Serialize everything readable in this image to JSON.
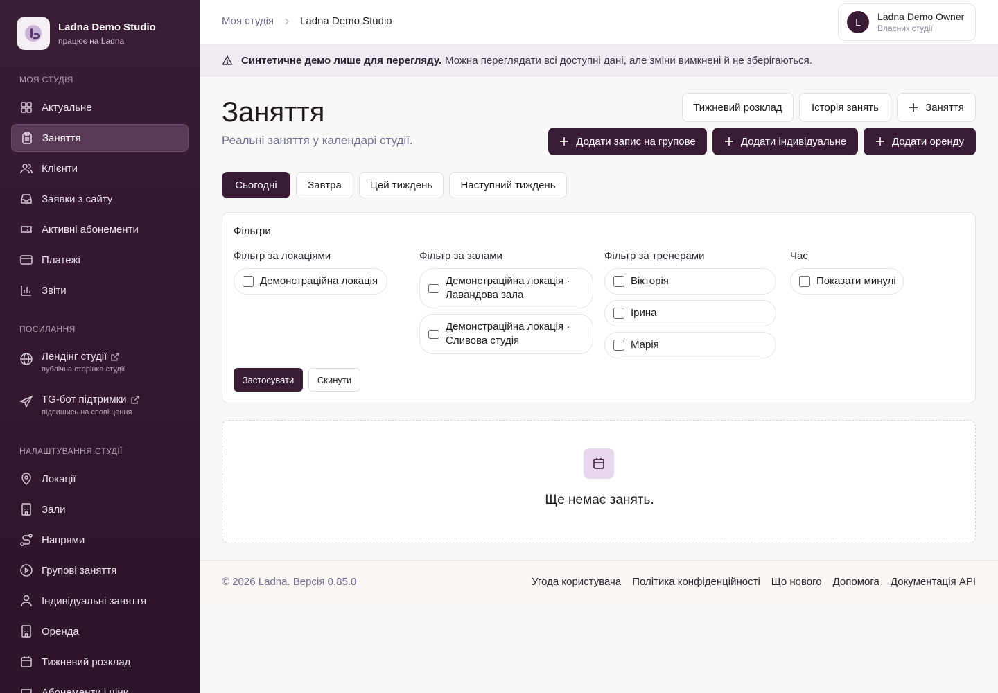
{
  "brand": {
    "name": "Ladna Demo Studio",
    "sub": "працює на Ladna"
  },
  "sidebar": {
    "sections": {
      "studio": "МОЯ СТУДІЯ",
      "links": "ПОСИЛАННЯ",
      "settings": "НАЛАШТУВАННЯ СТУДІЇ"
    },
    "studio_items": [
      {
        "label": "Актуальне",
        "icon": "dashboard-icon"
      },
      {
        "label": "Заняття",
        "icon": "clipboard-icon",
        "active": true
      },
      {
        "label": "Клієнти",
        "icon": "users-icon"
      },
      {
        "label": "Заявки з сайту",
        "icon": "inbox-icon"
      },
      {
        "label": "Активні абонементи",
        "icon": "ticket-icon"
      },
      {
        "label": "Платежі",
        "icon": "credit-card-icon"
      },
      {
        "label": "Звіти",
        "icon": "bar-chart-icon"
      }
    ],
    "link_items": [
      {
        "label": "Лендінг студії",
        "sub": "публічна сторінка студії",
        "icon": "globe-icon"
      },
      {
        "label": "TG-бот підтримки",
        "sub": "підпишись на сповіщення",
        "icon": "send-icon"
      }
    ],
    "settings_items": [
      {
        "label": "Локації",
        "icon": "map-pin-icon"
      },
      {
        "label": "Зали",
        "icon": "building-icon"
      },
      {
        "label": "Напрями",
        "icon": "route-icon"
      },
      {
        "label": "Групові заняття",
        "icon": "play-circle-icon"
      },
      {
        "label": "Індивідуальні заняття",
        "icon": "user-icon"
      },
      {
        "label": "Оренда",
        "icon": "building-icon"
      },
      {
        "label": "Тижневий розклад",
        "icon": "calendar-icon"
      },
      {
        "label": "Абонементи і ціни",
        "icon": "ticket-icon"
      }
    ]
  },
  "header": {
    "breadcrumb": {
      "parent": "Моя студія",
      "current": "Ladna Demo Studio"
    },
    "user": {
      "initial": "L",
      "name": "Ladna Demo Owner",
      "role": "Власник студії"
    }
  },
  "banner": {
    "strong": "Синтетичне демо лише для перегляду.",
    "text": "Можна переглядати всі доступні дані, але зміни вимкнені й не зберігаються."
  },
  "page": {
    "title": "Заняття",
    "subtitle": "Реальні заняття у календарі студії.",
    "top_buttons": {
      "weekly": "Тижневий розклад",
      "history": "Історія занять",
      "add_class": "Заняття"
    },
    "action_buttons": {
      "group": "Додати запис на групове",
      "individual": "Додати індивідуальне",
      "rent": "Додати оренду"
    },
    "tabs": [
      "Сьогодні",
      "Завтра",
      "Цей тиждень",
      "Наступний тиждень"
    ]
  },
  "filters": {
    "title": "Фільтри",
    "locations": {
      "label": "Фільтр за локаціями",
      "options": [
        "Демонстраційна локація"
      ]
    },
    "halls": {
      "label": "Фільтр за залами",
      "options": [
        [
          "Демонстраційна локація ·",
          "Лавандова зала"
        ],
        [
          "Демонстраційна локація ·",
          "Сливова студія"
        ]
      ]
    },
    "trainers": {
      "label": "Фільтр за тренерами",
      "options": [
        "Вікторія",
        "Ірина",
        "Марія"
      ]
    },
    "time": {
      "label": "Час",
      "options": [
        "Показати минулі"
      ]
    },
    "apply": "Застосувати",
    "reset": "Скинути"
  },
  "empty": {
    "text": "Ще немає занять."
  },
  "footer": {
    "copy": "© 2026 Ladna. Версія 0.85.0",
    "links": [
      "Угода користувача",
      "Політика конфіденційності",
      "Що нового",
      "Допомога",
      "Документація API"
    ]
  },
  "colors": {
    "accent": "#3a1c36",
    "banner_bg": "#f2ebf4",
    "empty_icon_bg": "#e6d6ee"
  }
}
